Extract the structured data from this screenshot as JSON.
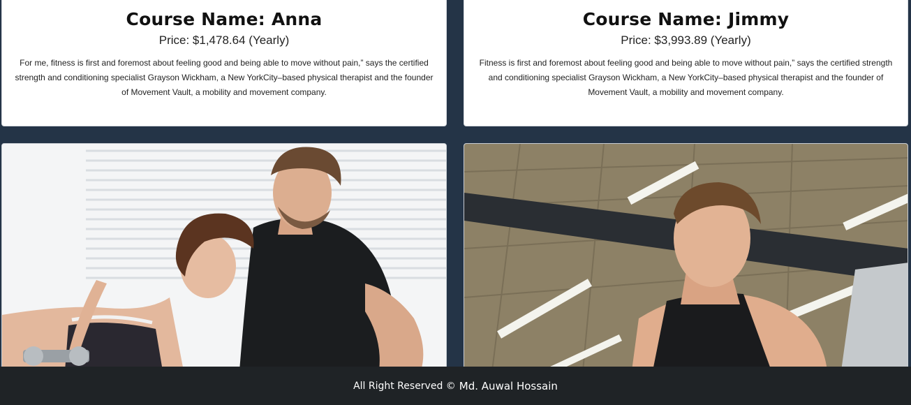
{
  "courses": [
    {
      "title": "Course Name: Anna",
      "price": "Price: $1,478.64 (Yearly)",
      "description": "For me, fitness is first and foremost about feeling good and being able to move without pain,” says the certified strength and conditioning specialist Grayson Wickham, a New YorkCity–based physical therapist and the founder of Movement Vault, a mobility and movement company."
    },
    {
      "title": "Course Name: Jimmy",
      "price": "Price: $3,993.89 (Yearly)",
      "description": "Fitness is first and foremost about feeling good and being able to move without pain,” says the certified strength and conditioning specialist Grayson Wickham, a New YorkCity–based physical therapist and the founder of Movement Vault, a mobility and movement company."
    }
  ],
  "footer": {
    "text": "All Right Reserved ©",
    "author": "Md. Auwal Hossain"
  },
  "colors": {
    "page_background": "#243447",
    "card_background": "#ffffff",
    "footer_background": "#1f2326"
  }
}
